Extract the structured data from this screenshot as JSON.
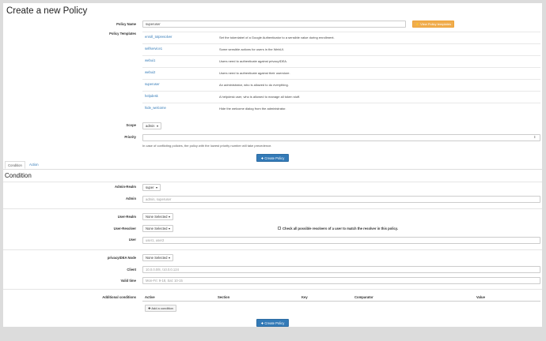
{
  "page": {
    "title": "Create a new Policy"
  },
  "policy_name": {
    "label": "Policy Name",
    "value": "superuser",
    "view_templates_label": "View Policy templates"
  },
  "templates": {
    "label": "Policy Templates",
    "items": [
      {
        "name": "enroll_totpresolver",
        "description": "Set the tokenlabel of a Google Authenticator to a sensible value during enrollment."
      },
      {
        "name": "selfservice1",
        "description": "Some sensible actions for users in the WebUI."
      },
      {
        "name": "webui1",
        "description": "Users need to authenticate against privacyIDEA."
      },
      {
        "name": "webui2",
        "description": "Users need to authenticate against their userstore."
      },
      {
        "name": "superuser",
        "description": "An administrator, who is allowed to do everything."
      },
      {
        "name": "helpdesk",
        "description": "A helpdesk user, who is allowed to manage all token stuff."
      },
      {
        "name": "hide_welcome",
        "description": "Hide the welcome dialog from the administrator."
      }
    ]
  },
  "scope": {
    "label": "Scope",
    "value": "admin"
  },
  "priority": {
    "label": "Priority",
    "value": "",
    "help": "In case of conflicting policies, the policy with the lowest priority number will take precedence."
  },
  "create_button_label": "Create Policy",
  "tabs": {
    "condition": "Condition",
    "action": "Action"
  },
  "condition": {
    "heading": "Condition",
    "admin_realm": {
      "label": "Admin-Realm",
      "value": "super"
    },
    "admin": {
      "label": "Admin",
      "placeholder": "admin, superuser"
    },
    "user_realm": {
      "label": "User-Realm",
      "value": "None Selected"
    },
    "user_resolver": {
      "label": "User-Resolver",
      "value": "None Selected",
      "check_label": "Check all possible resolvers of a user to match the resolver in this policy."
    },
    "user": {
      "label": "User",
      "placeholder": "user1, user2"
    },
    "pi_node": {
      "label": "privacyIDEA Node",
      "value": "None Selected"
    },
    "client": {
      "label": "Client",
      "placeholder": "10.0.0.0/8, !10.0.0.124"
    },
    "valid_time": {
      "label": "Valid time",
      "placeholder": "Mon-Fri: 9-18, Sat: 10-15"
    },
    "additional": {
      "label": "Additional conditions",
      "columns": [
        "Active",
        "Section",
        "Key",
        "Comparator",
        "Value"
      ],
      "add_label": "Add a condition"
    }
  },
  "colors": {
    "primary": "#337ab7",
    "warning": "#f0ad4e",
    "link": "#337ab7"
  }
}
